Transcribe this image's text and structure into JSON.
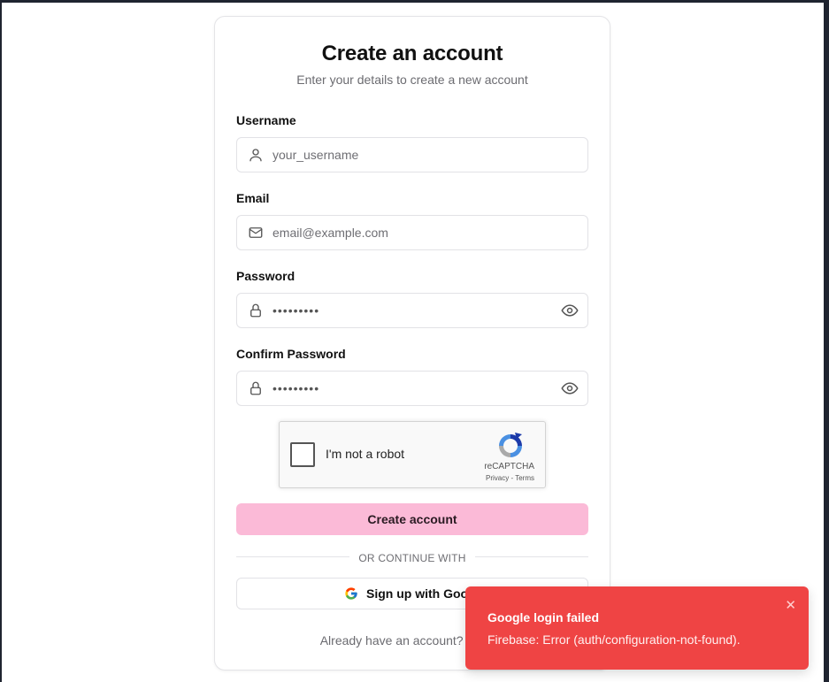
{
  "form": {
    "title": "Create an account",
    "subtitle": "Enter your details to create a new account",
    "username": {
      "label": "Username",
      "placeholder": "your_username",
      "icon": "user-icon"
    },
    "email": {
      "label": "Email",
      "placeholder": "email@example.com",
      "icon": "mail-icon"
    },
    "password": {
      "label": "Password",
      "masked_value": "•••••••••",
      "icon": "lock-icon",
      "toggle_icon": "eye-icon"
    },
    "confirm_password": {
      "label": "Confirm Password",
      "masked_value": "•••••••••",
      "icon": "lock-icon",
      "toggle_icon": "eye-icon"
    },
    "captcha": {
      "label": "I'm not a robot",
      "brand": "reCAPTCHA",
      "links": "Privacy - Terms"
    },
    "submit_label": "Create account",
    "divider_text": "OR CONTINUE WITH",
    "google_label": "Sign up with Google",
    "footer_text": "Already have an account? Sign in"
  },
  "toast": {
    "title": "Google login failed",
    "message": "Firebase: Error (auth/configuration-not-found).",
    "close_icon": "close-icon"
  },
  "colors": {
    "accent_button": "#fbbad7",
    "toast_error": "#ef4444",
    "frame": "#1f2430"
  }
}
